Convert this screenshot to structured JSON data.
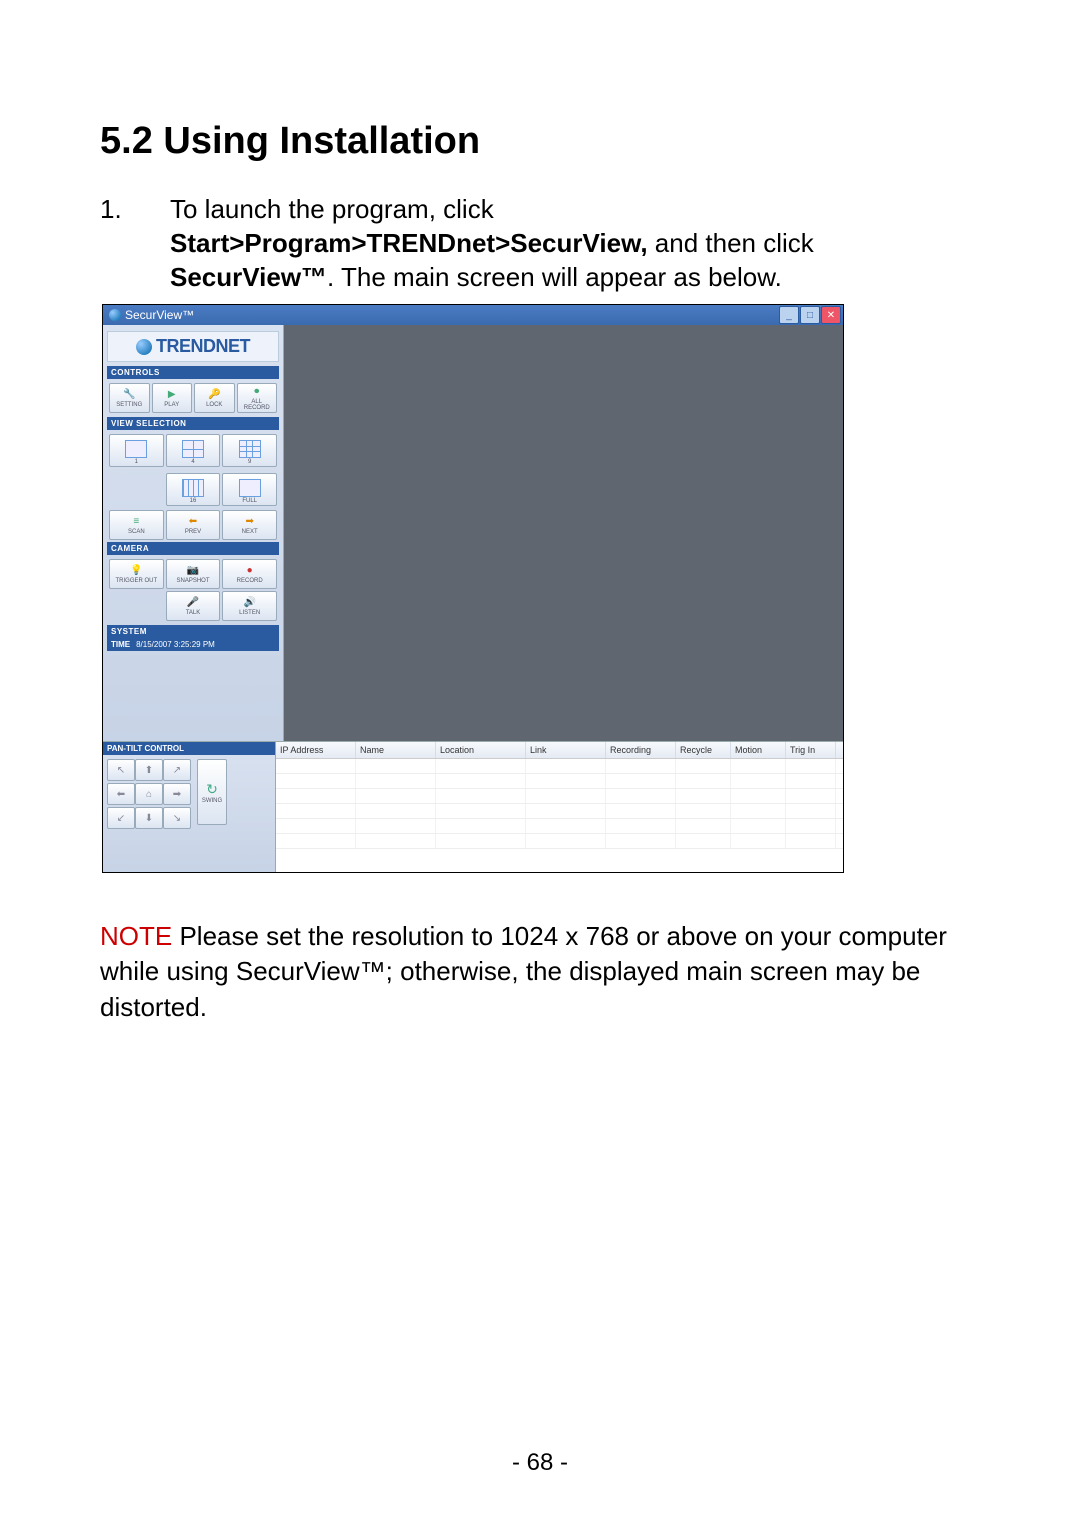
{
  "heading": "5.2    Using Installation",
  "step_num": "1.",
  "step_line1": "To launch the program, click",
  "step_path": "Start>Program>TRENDnet>SecurView,",
  "step_after_path": " and then click",
  "step_app": "SecurView™",
  "step_line3_rest": ".  The main screen will appear as below.",
  "titlebar": "SecurView™",
  "brand": "TRENDNET",
  "sections": {
    "controls": "CONTROLS",
    "view": "VIEW SELECTION",
    "camera": "CAMERA",
    "system": "SYSTEM",
    "pantilt": "PAN-TILT CONTROL"
  },
  "controls": {
    "setting": "SETTING",
    "play": "PLAY",
    "lock": "LOCK",
    "allrec": "ALL RECORD"
  },
  "views": {
    "v1": "1",
    "v4": "4",
    "v9": "9",
    "v16": "16",
    "full": "FULL"
  },
  "nav": {
    "scan": "SCAN",
    "prev": "PREV",
    "next": "NEXT"
  },
  "camera": {
    "trigger": "TRIGGER OUT",
    "snapshot": "SNAPSHOT",
    "record": "RECORD",
    "talk": "TALK",
    "listen": "LISTEN"
  },
  "system": {
    "time_label": "TIME",
    "time_value": "8/15/2007 3:25:29 PM"
  },
  "ptc_swing": "SWING",
  "columns": {
    "ip": "IP Address",
    "name": "Name",
    "location": "Location",
    "link": "Link",
    "recording": "Recording",
    "recycle": "Recycle",
    "motion": "Motion",
    "trig": "Trig In"
  },
  "note_label": "NOTE",
  "note_text": " Please set the resolution to 1024 x 768 or above on your computer while using SecurView™; otherwise, the displayed main screen may be distorted.",
  "page_num": "- 68 -"
}
